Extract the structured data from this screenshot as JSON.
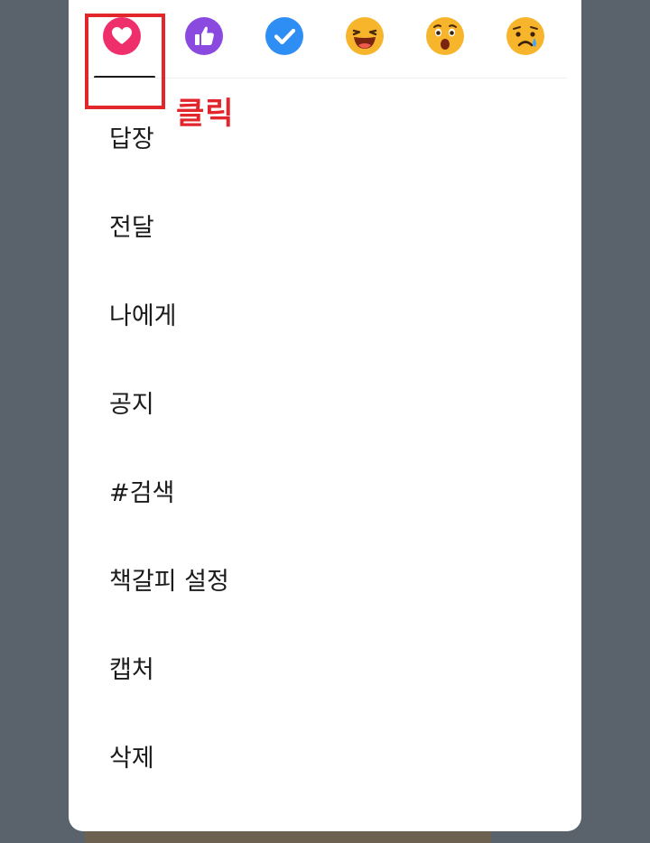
{
  "annotation": {
    "click_label": "클릭",
    "color": "#e1262c"
  },
  "reactions": [
    {
      "name": "heart",
      "icon": "heart-icon",
      "color": "#ef2f6b",
      "selected": true
    },
    {
      "name": "thumbs-up",
      "icon": "thumbs-up-icon",
      "color": "#8a4ae0",
      "selected": false
    },
    {
      "name": "check",
      "icon": "check-icon",
      "color": "#2f8ef4",
      "selected": false
    },
    {
      "name": "laugh",
      "icon": "laughing-face-icon",
      "color": "#f7b52c",
      "selected": false
    },
    {
      "name": "surprised",
      "icon": "surprised-face-icon",
      "color": "#f7b52c",
      "selected": false
    },
    {
      "name": "sad",
      "icon": "sad-tear-face-icon",
      "color": "#f7b52c",
      "selected": false
    }
  ],
  "menu": {
    "items": [
      {
        "label": "답장"
      },
      {
        "label": "전달"
      },
      {
        "label": "나에게"
      },
      {
        "label": "공지"
      },
      {
        "label": "#검색"
      },
      {
        "label": "책갈피 설정"
      },
      {
        "label": "캡처"
      },
      {
        "label": "삭제"
      }
    ]
  }
}
